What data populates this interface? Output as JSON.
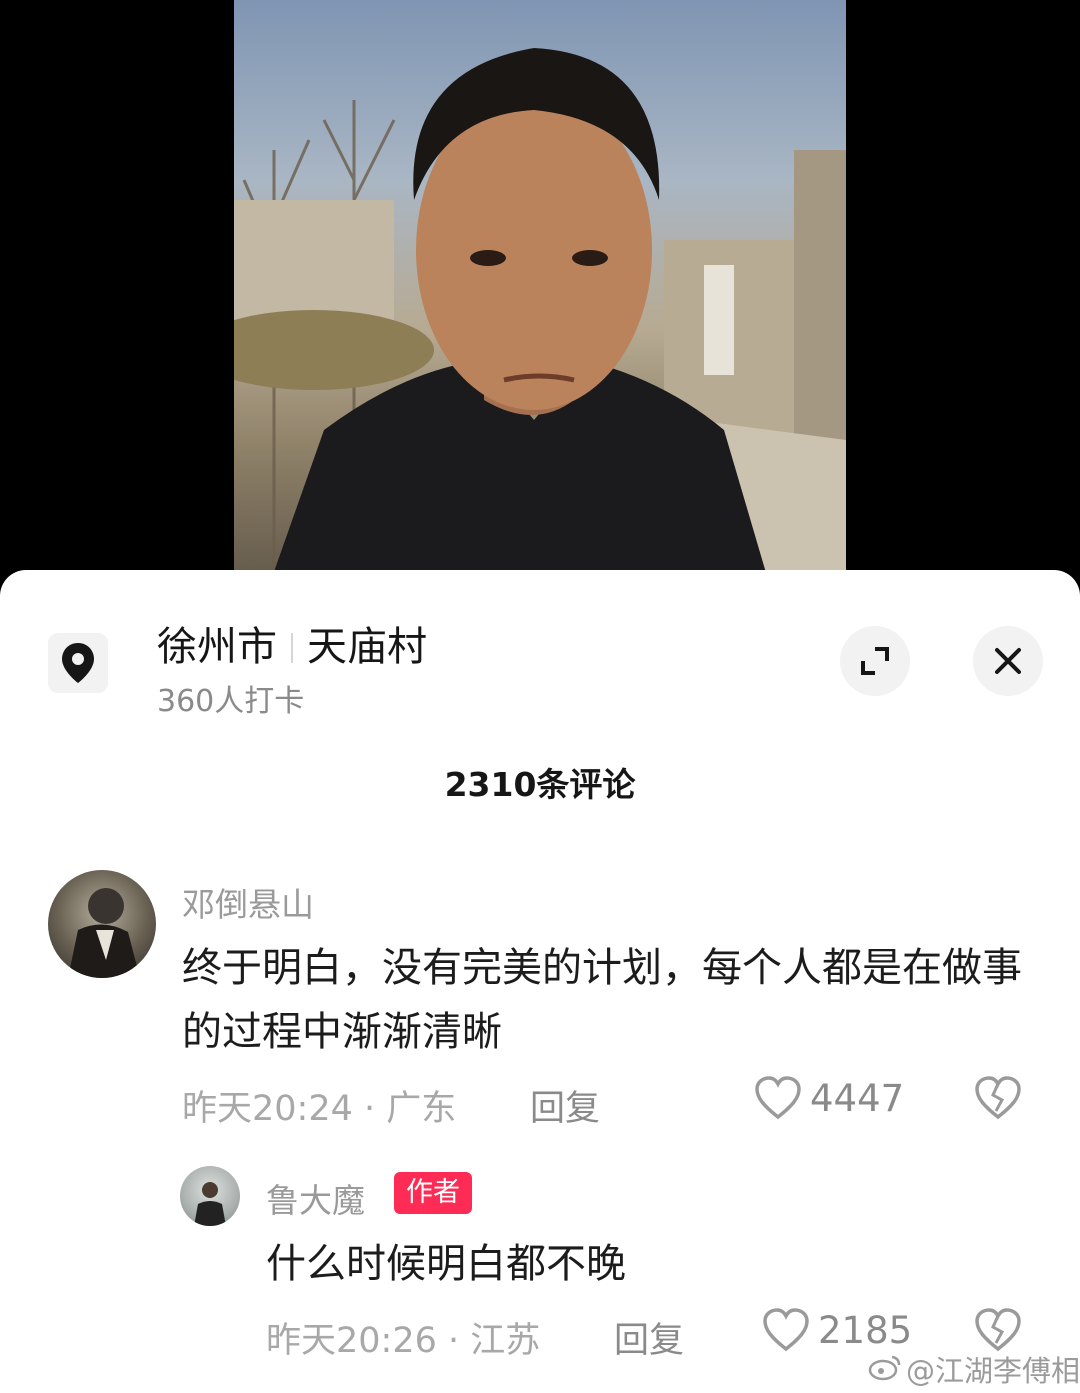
{
  "location": {
    "city": "徐州市",
    "place": "天庙村",
    "checkin_count": "360人打卡"
  },
  "comments_header": "2310条评论",
  "comments": [
    {
      "username": "邓倒悬山",
      "text": "终于明白，没有完美的计划，每个人都是在做事的过程中渐渐清晰",
      "meta": "昨天20:24 · 广东",
      "reply_label": "回复",
      "likes": "4447"
    },
    {
      "username": "鲁大魔",
      "badge": "作者",
      "text": "什么时候明白都不晚",
      "meta": "昨天20:26 · 江苏",
      "reply_label": "回复",
      "likes": "2185"
    }
  ],
  "watermark": "@江湖李傅相",
  "icons": [
    "location-pin-icon",
    "expand-icon",
    "close-icon",
    "heart-icon",
    "broken-heart-icon",
    "weibo-logo-icon"
  ],
  "colors": {
    "badge": "#fe2c55",
    "sheet_bg": "#ffffff",
    "secondary_text": "#9a9a9a"
  }
}
